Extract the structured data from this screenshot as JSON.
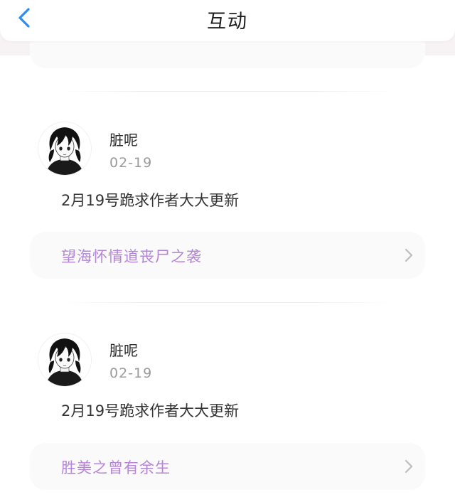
{
  "header": {
    "title": "互动",
    "back_icon": "chevron-left-icon",
    "accent_color": "#2d8cf0"
  },
  "items": [
    {
      "user_name": "脏呢",
      "date": "02-19",
      "comment": "2月19号跪求作者大大更新",
      "book_title": "望海怀情道丧尸之袭"
    },
    {
      "user_name": "脏呢",
      "date": "02-19",
      "comment": "2月19号跪求作者大大更新",
      "book_title": "胜美之曾有余生"
    }
  ],
  "colors": {
    "book_title": "#b485d6",
    "card_background": "#fafafa",
    "date_text": "#9a9a9a"
  }
}
